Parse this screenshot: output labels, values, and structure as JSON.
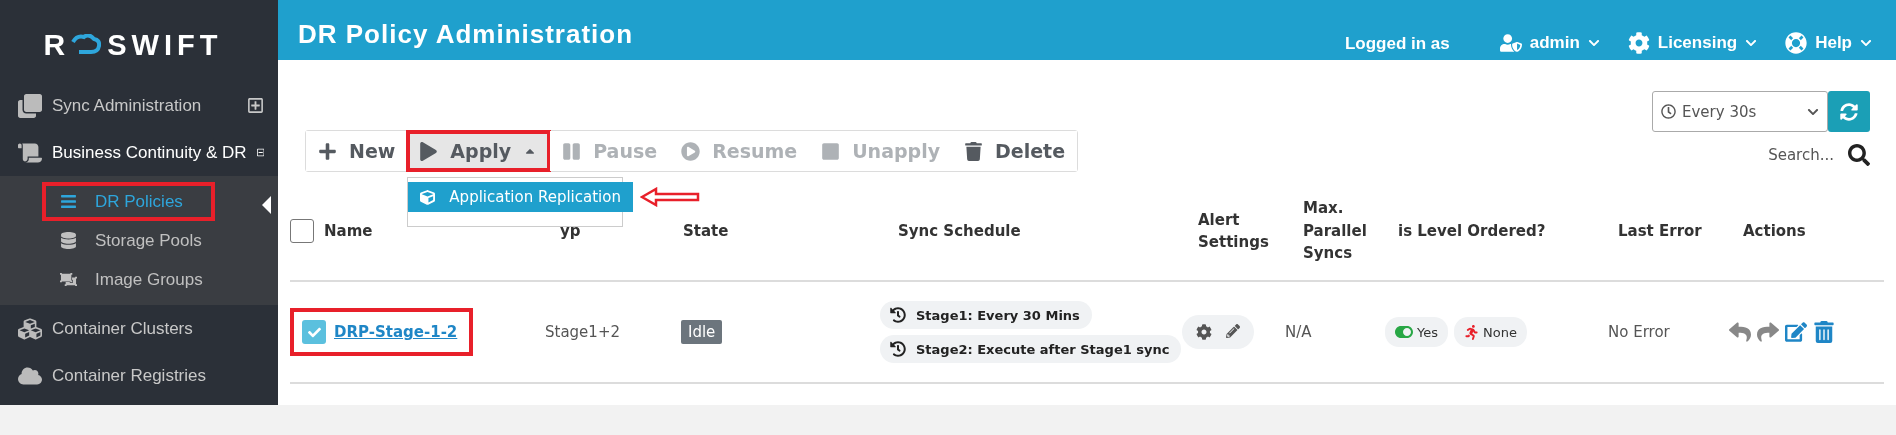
{
  "sidebar": {
    "logo": {
      "letter": "R",
      "name": "SWIFT"
    },
    "items": [
      {
        "kind": "group",
        "label": "Sync Administration",
        "expanded": false,
        "selected": false
      },
      {
        "kind": "group",
        "label": "Business Continuity & DR",
        "expanded": true,
        "selected": true,
        "children": [
          {
            "label": "DR Policies",
            "selected": true,
            "highlighted": true
          },
          {
            "label": "Storage Pools",
            "selected": false,
            "highlighted": false
          },
          {
            "label": "Image Groups",
            "selected": false,
            "highlighted": false
          }
        ]
      },
      {
        "kind": "link",
        "label": "Container Clusters",
        "selected": false
      },
      {
        "kind": "link",
        "label": "Container Registries",
        "selected": false
      }
    ]
  },
  "header": {
    "title": "DR Policy Administration",
    "user_prefix": "Logged in as",
    "menus": [
      {
        "kind": "user",
        "label": "admin"
      },
      {
        "kind": "gear",
        "label": "Licensing"
      },
      {
        "kind": "help",
        "label": "Help"
      }
    ]
  },
  "refresh": {
    "interval": "Every 30s"
  },
  "search": {
    "placeholder": "Search..."
  },
  "toolbar": [
    {
      "kind": "new",
      "label": "New",
      "disabled": false
    },
    {
      "kind": "apply",
      "label": "Apply",
      "disabled": false,
      "expanded": true,
      "highlighted": true,
      "menu": [
        {
          "label": "Application Replication",
          "selected": true,
          "highlighted": true
        }
      ]
    },
    {
      "kind": "pause",
      "label": "Pause",
      "disabled": true
    },
    {
      "kind": "resume",
      "label": "Resume",
      "disabled": true
    },
    {
      "kind": "unapply",
      "label": "Unapply",
      "disabled": true
    },
    {
      "kind": "delete",
      "label": "Delete",
      "disabled": false
    }
  ],
  "table": {
    "select_all_checked": false,
    "columns": [
      "Name",
      "yp",
      "State",
      "Sync Schedule",
      "Alert Settings",
      "Max. Parallel Syncs",
      "is Level Ordered?",
      "Last Error",
      "Actions"
    ],
    "rows": [
      {
        "checked": true,
        "highlighted": true,
        "name": "DRP-Stage-1-2",
        "type": "Stage1+2",
        "state": "Idle",
        "schedules": [
          "Stage1: Every 30 Mins",
          "Stage2: Execute after Stage1 sync"
        ],
        "max_parallel": "N/A",
        "level_ordered": {
          "on": true,
          "label": "Yes"
        },
        "order_mode": "None",
        "last_error": "No Error"
      }
    ]
  }
}
